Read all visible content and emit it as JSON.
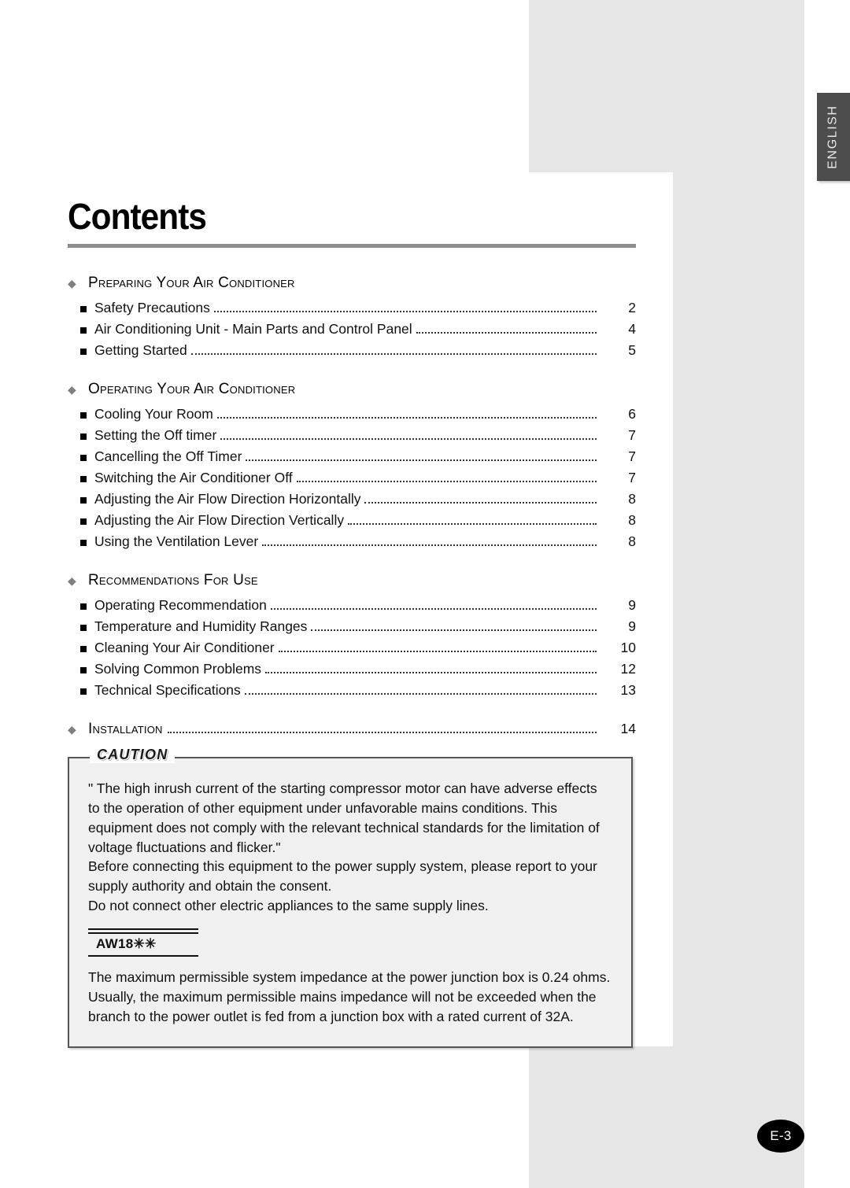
{
  "language_tab": {
    "label": "ENGLISH"
  },
  "page_title": "Contents",
  "page_badge": "E-3",
  "toc": {
    "sections": [
      {
        "bullet": "diamond-bullet",
        "label": "Preparing Your Air Conditioner",
        "items": [
          {
            "label": "Safety Precautions",
            "page": "2"
          },
          {
            "label": "Air Conditioning Unit - Main Parts and Control Panel",
            "page": "4"
          },
          {
            "label": "Getting Started",
            "page": "5"
          }
        ]
      },
      {
        "bullet": "diamond-bullet",
        "label": "Operating Your Air Conditioner",
        "items": [
          {
            "label": "Cooling Your Room",
            "page": "6"
          },
          {
            "label": "Setting the Off timer",
            "page": "7"
          },
          {
            "label": "Cancelling the Off Timer",
            "page": "7"
          },
          {
            "label": "Switching the Air Conditioner Off",
            "page": "7"
          },
          {
            "label": "Adjusting the Air Flow Direction Horizontally",
            "page": "8"
          },
          {
            "label": "Adjusting the Air Flow Direction Vertically",
            "page": "8"
          },
          {
            "label": "Using the Ventilation Lever",
            "page": "8"
          }
        ]
      },
      {
        "bullet": "diamond-bullet",
        "label": "Recommendations For Use",
        "items": [
          {
            "label": "Operating Recommendation",
            "page": "9"
          },
          {
            "label": "Temperature and Humidity Ranges",
            "page": "9"
          },
          {
            "label": "Cleaning Your Air Conditioner",
            "page": "10"
          },
          {
            "label": "Solving Common Problems",
            "page": "12"
          },
          {
            "label": "Technical Specifications",
            "page": "13"
          }
        ]
      }
    ],
    "standalone_section": {
      "bullet": "diamond-bullet",
      "label": "Installation",
      "page": "14"
    }
  },
  "caution": {
    "tag": "CAUTION",
    "paragraphs": [
      "\" The high inrush current of the starting compressor motor can have adverse effects to the operation of other equipment under unfavorable mains conditions. This equipment does not comply with the relevant technical standards for the limitation of voltage fluctuations and flicker.\"",
      "Before connecting this equipment to the power supply system, please report to your supply authority and obtain the consent.",
      "Do not connect other electric appliances to the same supply lines."
    ],
    "model": "AW18✳✳",
    "model_paragraph": "The maximum permissible system impedance at the power junction box is 0.24 ohms. Usually, the maximum permissible mains impedance will not be exceeded when the branch to the power outlet is fed from a junction box with a rated current of 32A."
  },
  "colors": {
    "page_bg": "#ffffff",
    "block_gray": "#e6e6e6",
    "tab_bg": "#4d4d4d",
    "rule_gray": "#8c8c8c",
    "caution_fill": "#f0f0f0",
    "caution_border": "#555555"
  }
}
